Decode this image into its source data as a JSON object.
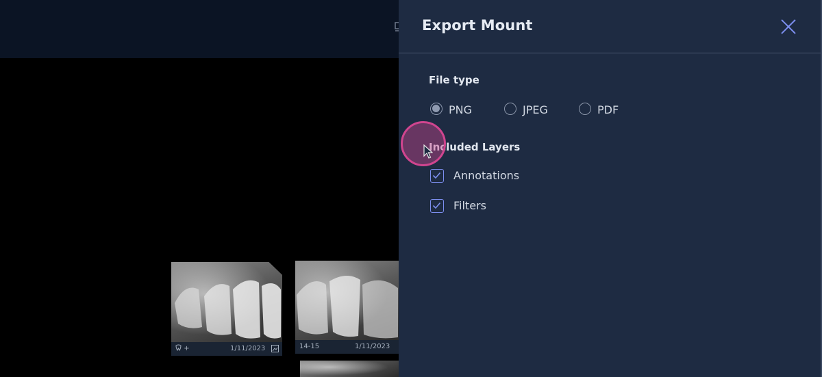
{
  "panel": {
    "title": "Export Mount",
    "file_type": {
      "title": "File type",
      "options": [
        {
          "label": "PNG",
          "checked": true
        },
        {
          "label": "JPEG",
          "checked": false
        },
        {
          "label": "PDF",
          "checked": false
        }
      ]
    },
    "layers": {
      "title": "Included Layers",
      "options": [
        {
          "label": "Annotations",
          "checked": true
        },
        {
          "label": "Filters",
          "checked": true
        }
      ]
    }
  },
  "thumbnails": [
    {
      "tooth": "+",
      "date": "1/11/2023"
    },
    {
      "tooth": "14-15",
      "date": "1/11/2023"
    }
  ],
  "colors": {
    "panel_bg": "#1e2b42",
    "accent": "#7d8ff0",
    "click_highlight": "#d0458f"
  },
  "icons": [
    "close-icon",
    "tooth-icon",
    "image-icon",
    "mouse-cursor-icon",
    "radio-icon",
    "checkbox-icon"
  ]
}
